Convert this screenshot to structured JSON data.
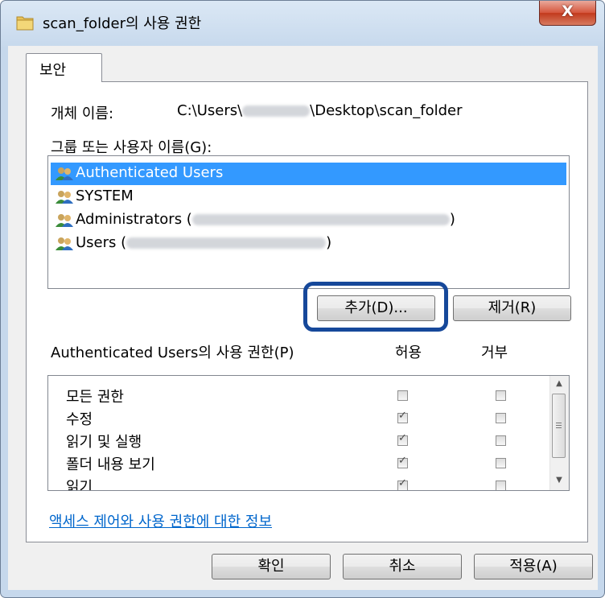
{
  "window": {
    "title": "scan_folder의 사용 권한",
    "close_label": "X"
  },
  "tabs": [
    {
      "label": "보안"
    }
  ],
  "object_name": {
    "label": "개체 이름:",
    "path_prefix": "C:\\Users\\",
    "path_suffix": "\\Desktop\\scan_folder"
  },
  "groups": {
    "label": "그룹 또는 사용자 이름(G):",
    "items": [
      {
        "name": "Authenticated Users",
        "selected": true
      },
      {
        "name": "SYSTEM",
        "selected": false
      },
      {
        "name": "Administrators (",
        "suffix": ")",
        "selected": false
      },
      {
        "name": "Users (",
        "suffix": ")",
        "selected": false
      }
    ],
    "add_label": "추가(D)...",
    "remove_label": "제거(R)"
  },
  "permissions": {
    "label": "Authenticated Users의 사용 권한(P)",
    "allow_header": "허용",
    "deny_header": "거부",
    "items": [
      {
        "name": "모든 권한",
        "allow": false,
        "deny": false
      },
      {
        "name": "수정",
        "allow": true,
        "deny": false
      },
      {
        "name": "읽기 및 실행",
        "allow": true,
        "deny": false
      },
      {
        "name": "폴더 내용 보기",
        "allow": true,
        "deny": false
      },
      {
        "name": "읽기",
        "allow": true,
        "deny": false
      }
    ]
  },
  "info_link": "액세스 제어와 사용 권한에 대한 정보",
  "footer": {
    "ok_label": "확인",
    "cancel_label": "취소",
    "apply_label": "적용(A)"
  },
  "colors": {
    "selection": "#3399ff",
    "highlight_ring": "#16489a",
    "link": "#0066cc",
    "close_button": "#c23a1d"
  }
}
